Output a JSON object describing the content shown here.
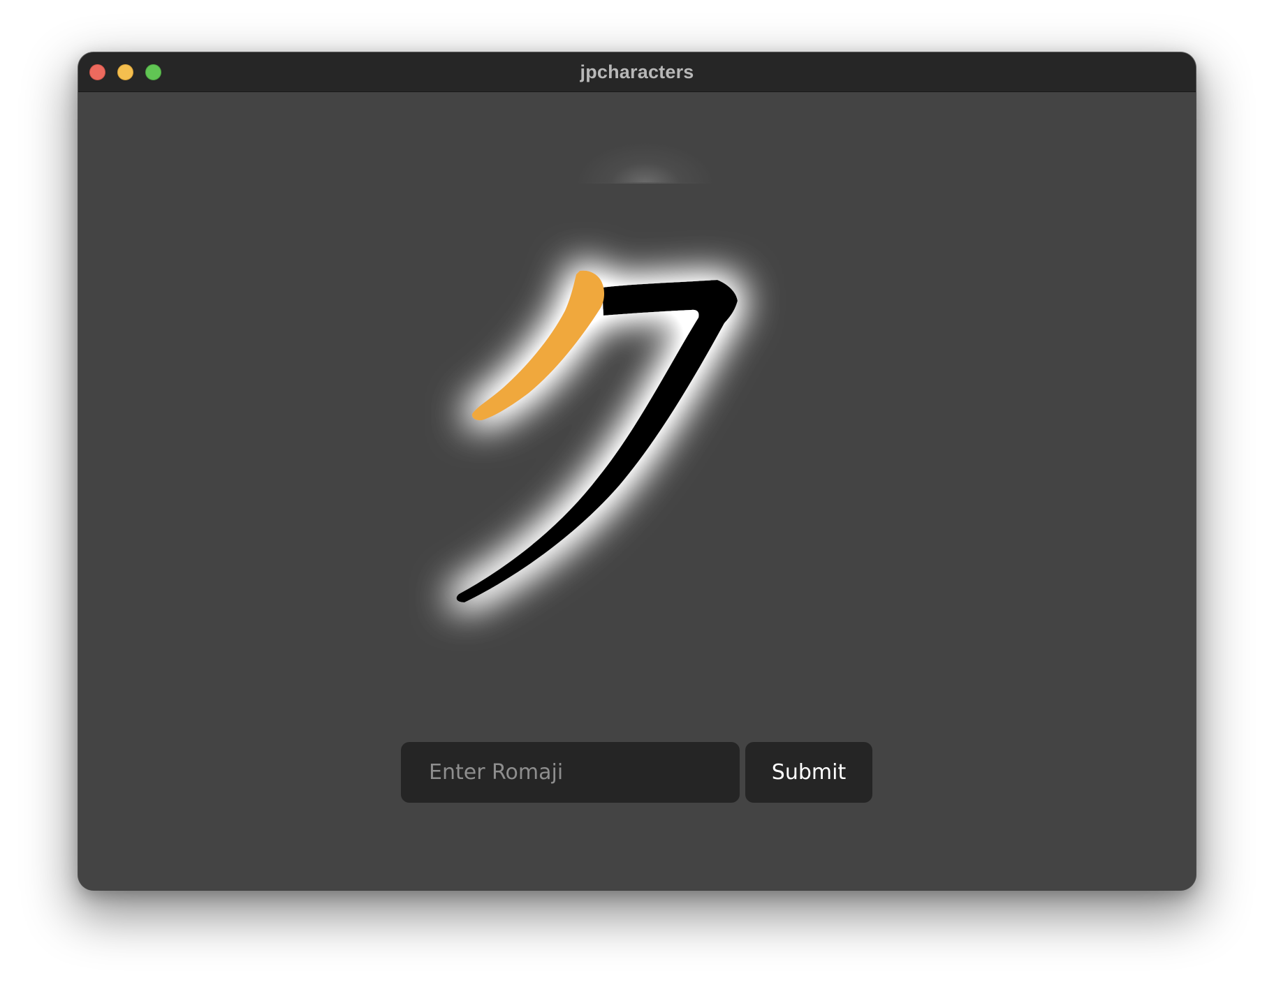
{
  "window": {
    "title": "jpcharacters"
  },
  "titlebar": {
    "buttons": [
      "close",
      "minimize",
      "maximize"
    ]
  },
  "character": {
    "glyph": "ク",
    "highlighted_stroke": 1,
    "stroke_count": 2,
    "highlight_color": "#f0a83c",
    "stroke_color": "#000000",
    "glow_color": "#ffffff"
  },
  "answer": {
    "input_value": "",
    "input_placeholder": "Enter Romaji",
    "submit_label": "Submit"
  },
  "colors": {
    "window_background": "#444444",
    "titlebar_background": "#262626",
    "control_background": "#252525"
  }
}
